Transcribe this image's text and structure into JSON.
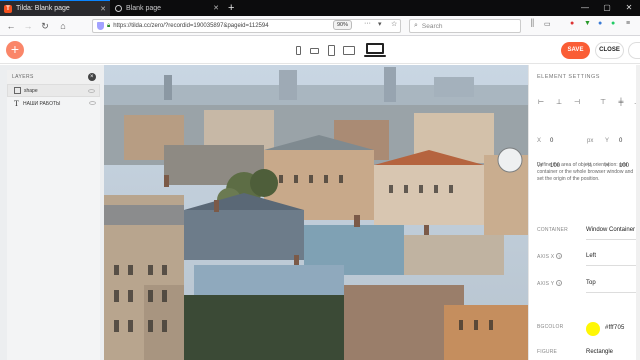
{
  "browser": {
    "tabs": [
      {
        "title": "Tilda: Blank page",
        "active": true
      },
      {
        "title": "Blank page",
        "active": false
      }
    ],
    "new_tab": "+",
    "window_controls": [
      "—",
      "▢",
      "✕"
    ],
    "url": "https://tilda.cc/zero/?recordid=190035897&pageid=112594",
    "zoom": "90%",
    "search_placeholder": "Search"
  },
  "toolbar": {
    "add_label": "+",
    "save_label": "SAVE",
    "close_label": "CLOSE",
    "devices": [
      "desktop-large",
      "tablet-landscape",
      "tablet-portrait",
      "mobile-landscape",
      "mobile-portrait"
    ]
  },
  "layers_panel": {
    "title": "LAYERS",
    "close": "×",
    "items": [
      {
        "label": "shape",
        "type": "shape",
        "selected": true
      },
      {
        "label": "НАШИ РАБОТЫ",
        "type": "text",
        "selected": false
      }
    ]
  },
  "settings_panel": {
    "title": "ELEMENT SETTINGS",
    "x_label": "X",
    "x_value": "0",
    "x_unit": "px",
    "y_label": "Y",
    "y_value": "0",
    "w_label": "W",
    "w_value": "100",
    "w_unit": "%",
    "h_label": "H",
    "h_value": "100",
    "description": "Define the area of object orientation: grid container or the whole browser window and set the origin of the position.",
    "container_label": "CONTAINER",
    "container_value": "Window Container",
    "axis_x_label": "AXIS X",
    "axis_x_value": "Left",
    "axis_y_label": "AXIS Y",
    "axis_y_value": "Top",
    "bgcolor_label": "BGCOLOR",
    "bgcolor_value": "#fff705",
    "figure_label": "FIGURE",
    "figure_value": "Rectangle"
  },
  "colors": {
    "accent": "#fa5d35",
    "add_button": "#fa8669",
    "bgcolor_swatch": "#fff705"
  }
}
